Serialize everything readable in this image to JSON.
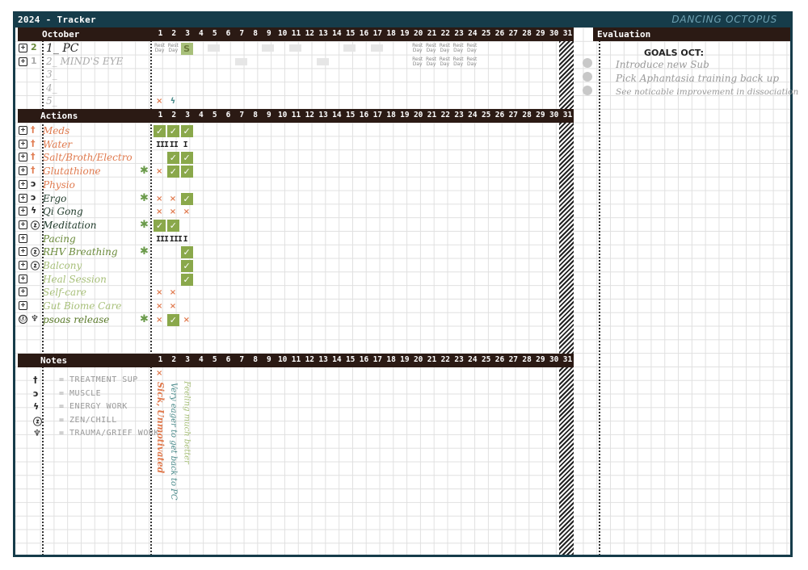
{
  "header": {
    "title": "2024 - Tracker",
    "brand": "DANCING OCTOPUS"
  },
  "sections": {
    "month": "October",
    "actions": "Actions",
    "notes": "Notes",
    "evaluation": "Evaluation"
  },
  "days": [
    "1",
    "2",
    "3",
    "4",
    "5",
    "6",
    "7",
    "8",
    "9",
    "10",
    "11",
    "12",
    "13",
    "14",
    "15",
    "16",
    "17",
    "18",
    "19",
    "20",
    "21",
    "22",
    "23",
    "24",
    "25",
    "26",
    "27",
    "28",
    "29",
    "30",
    "31"
  ],
  "goals_rows": [
    {
      "num": "2",
      "label": "1_ PC"
    },
    {
      "num": "1",
      "label": "2_ MIND'S EYE"
    },
    {
      "num": "",
      "label": "3_"
    },
    {
      "num": "",
      "label": "4_"
    },
    {
      "num": "",
      "label": "5_"
    }
  ],
  "rest_label": "Rest Day",
  "pc_mark": "S",
  "actions": [
    {
      "label": "Meds",
      "color": "#e07a4e",
      "icon2": "†"
    },
    {
      "label": "Water",
      "color": "#e07a4e",
      "icon2": "†"
    },
    {
      "label": "Salt/Broth/Electro",
      "color": "#e07a4e",
      "icon2": "†"
    },
    {
      "label": "Glutathione",
      "color": "#e07a4e",
      "icon2": "†"
    },
    {
      "label": "Physio",
      "color": "#e07a4e",
      "icon2": "ɔ"
    },
    {
      "label": "Ergo",
      "color": "#1f3a2a",
      "icon2": "ɔ"
    },
    {
      "label": "Qi Gong",
      "color": "#1f3a2a",
      "icon2": "ϟ"
    },
    {
      "label": "Meditation",
      "color": "#1f3a2a",
      "icon2": "ⓩ"
    },
    {
      "label": "Pacing",
      "color": "#6a8a3a",
      "icon2": ""
    },
    {
      "label": "RHV Breathing",
      "color": "#6a8a3a",
      "icon2": "ⓩ"
    },
    {
      "label": "Balcony",
      "color": "#a8c07a",
      "icon2": "ⓩ"
    },
    {
      "label": "Heal Session",
      "color": "#a8c07a",
      "icon2": ""
    },
    {
      "label": "Self-care",
      "color": "#a8c07a",
      "icon2": ""
    },
    {
      "label": "Gut Biome Care",
      "color": "#a8c07a",
      "icon2": ""
    },
    {
      "label": "psoas release",
      "color": "#5a7a2a",
      "icon2": "♆"
    }
  ],
  "legend": [
    {
      "icon": "†",
      "text": "= TREATMENT SUP"
    },
    {
      "icon": "ɔ",
      "text": "= MUSCLE"
    },
    {
      "icon": "ϟ",
      "text": "= ENERGY WORK"
    },
    {
      "icon": "ⓩ",
      "text": "= ZEN/CHILL"
    },
    {
      "icon": "♆",
      "text": "= TRAUMA/GRIEF WORK"
    }
  ],
  "day_notes": [
    {
      "text": "Sick, Unmotivated",
      "color": "#e07a4e"
    },
    {
      "text": "Very eager to get back to PC",
      "color": "#4a8a8a"
    },
    {
      "text": "Feeling much better",
      "color": "#a8c07a"
    }
  ],
  "eval": {
    "title": "GOALS OCT:",
    "items": [
      "Introduce new Sub",
      "Pick Aphantasia training back up",
      "See noticable improvement in dissociation"
    ]
  },
  "marks": {
    "check": "✓",
    "x": "×",
    "star": "✱"
  }
}
